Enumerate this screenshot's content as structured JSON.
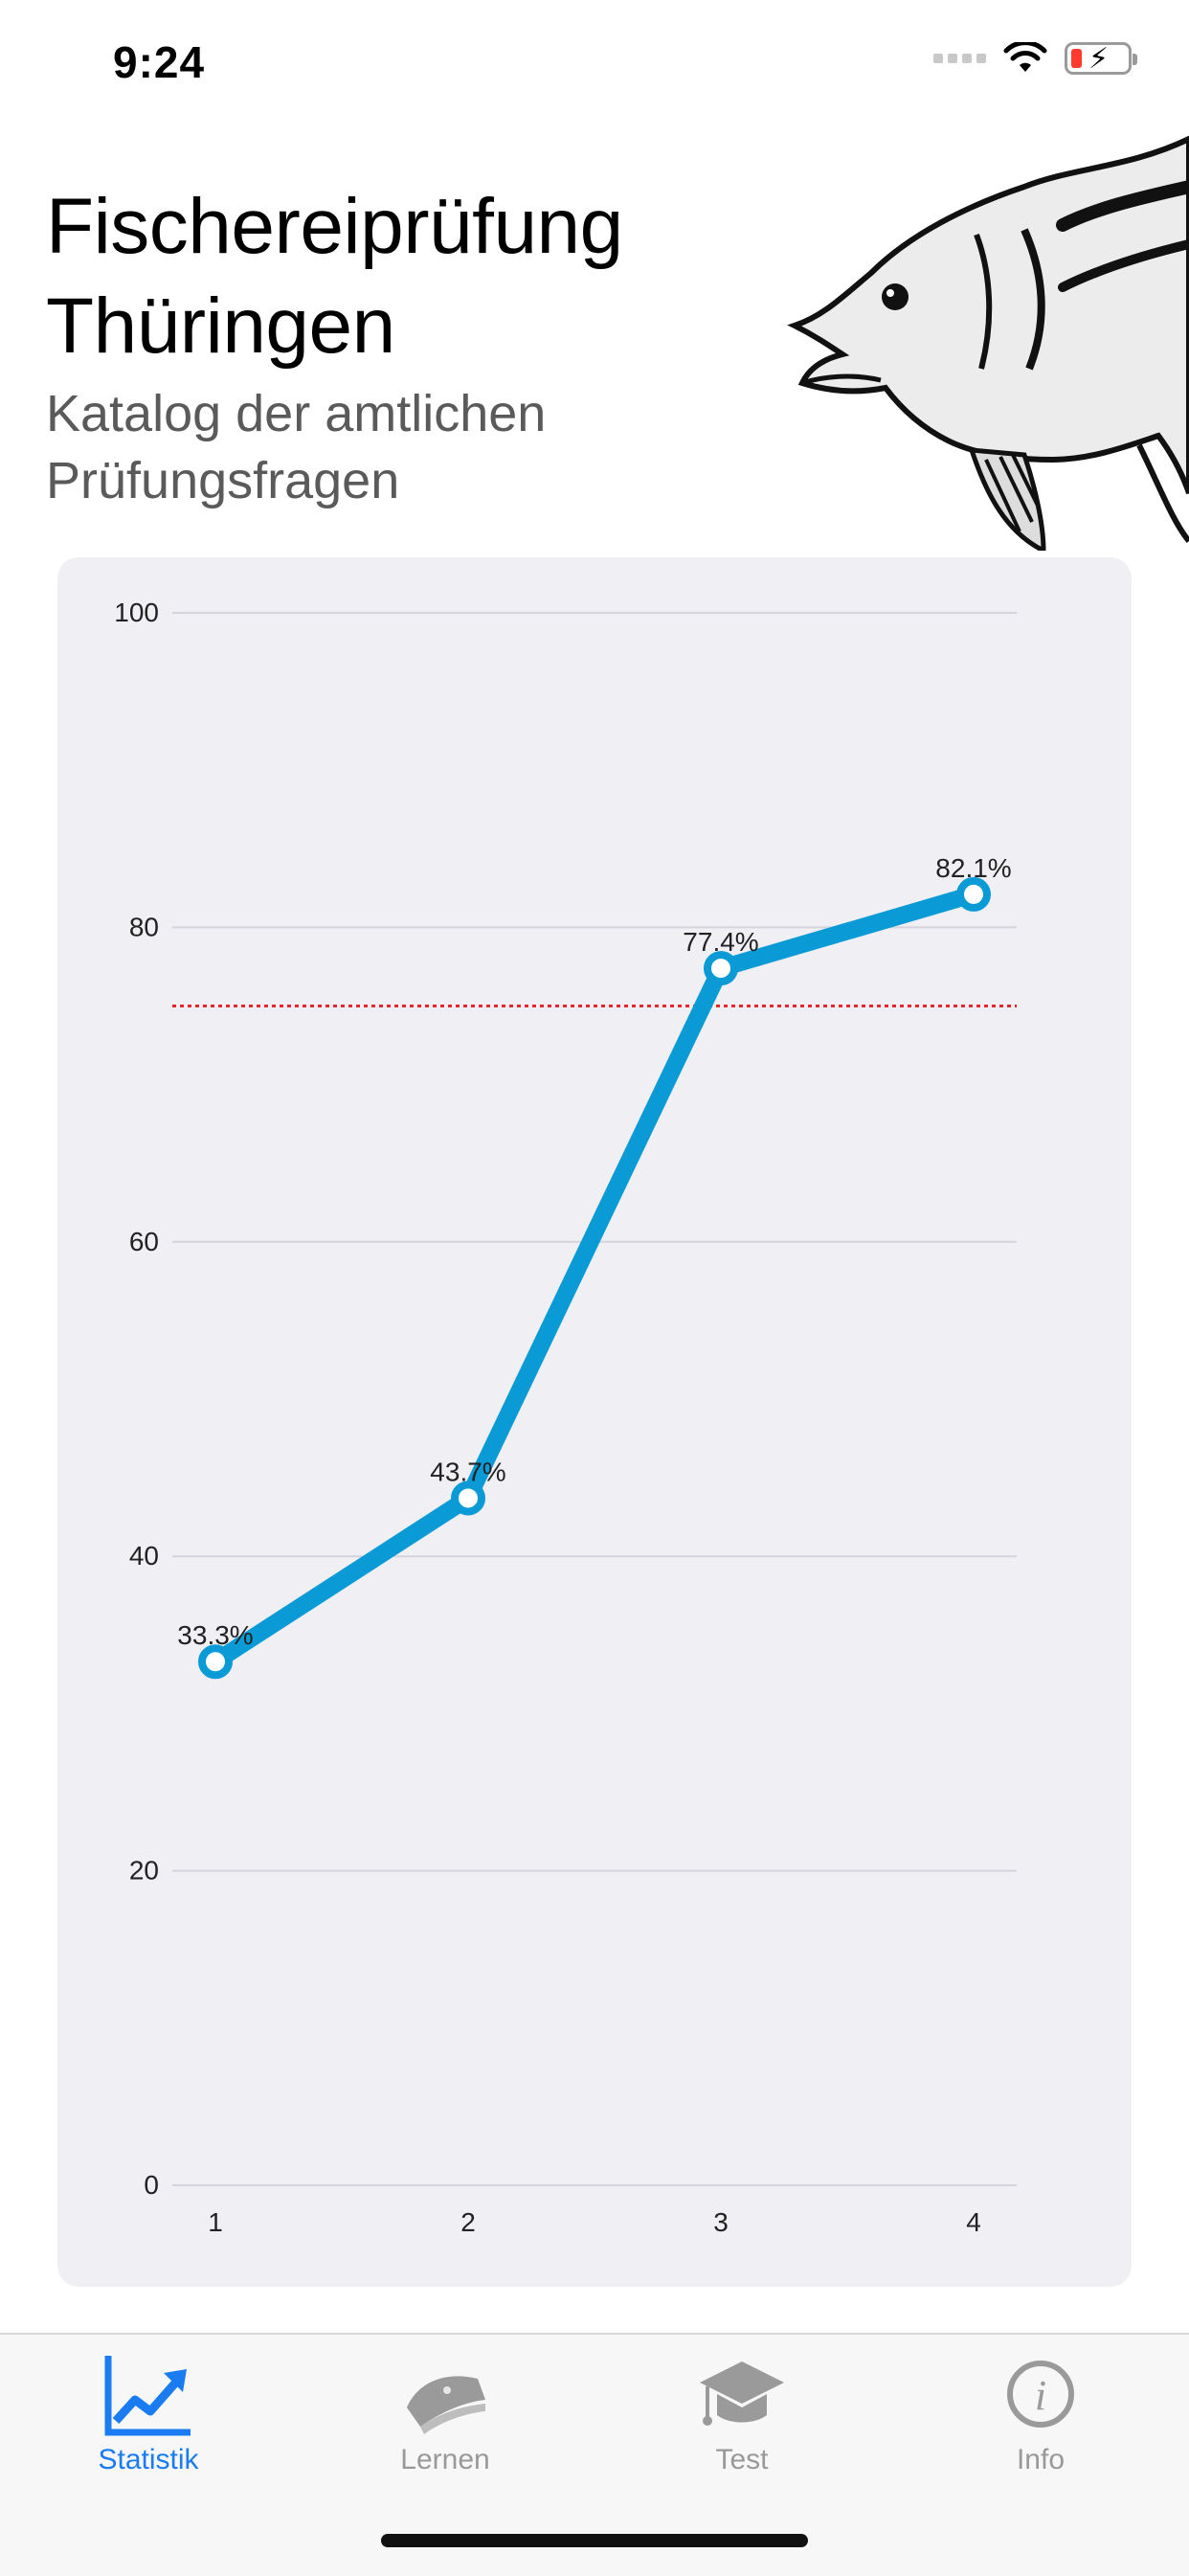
{
  "status_bar": {
    "time": "9:24"
  },
  "header": {
    "title_line1": "Fischereiprüfung",
    "title_line2": "Thüringen",
    "subtitle_line1": "Katalog der amtlichen",
    "subtitle_line2": "Prüfungsfragen"
  },
  "chart_data": {
    "type": "line",
    "title": "",
    "xlabel": "",
    "ylabel": "",
    "x": [
      1,
      2,
      3,
      4
    ],
    "series": [
      {
        "values": [
          33.3,
          43.7,
          77.4,
          82.1
        ],
        "labels": [
          "33.3%",
          "43.7%",
          "77.4%",
          "82.1%"
        ],
        "color": "#0a9bd6"
      }
    ],
    "threshold": {
      "value": 75,
      "color": "#e0282d",
      "style": "dotted"
    },
    "yticks": [
      "0",
      "20",
      "40",
      "60",
      "80",
      "100"
    ],
    "xticks": [
      "1",
      "2",
      "3",
      "4"
    ],
    "ylim": [
      0,
      100
    ],
    "xlim": [
      1,
      4
    ],
    "grid": true,
    "legend": "none"
  },
  "tabs": [
    {
      "label": "Statistik",
      "icon": "chart-up-icon",
      "active": true
    },
    {
      "label": "Lernen",
      "icon": "book-icon",
      "active": false
    },
    {
      "label": "Test",
      "icon": "graduation-cap-icon",
      "active": false
    },
    {
      "label": "Info",
      "icon": "info-icon",
      "active": false
    }
  ],
  "colors": {
    "accent": "#1a7cf0",
    "inactive": "#999999",
    "card_bg": "#efeff4"
  }
}
